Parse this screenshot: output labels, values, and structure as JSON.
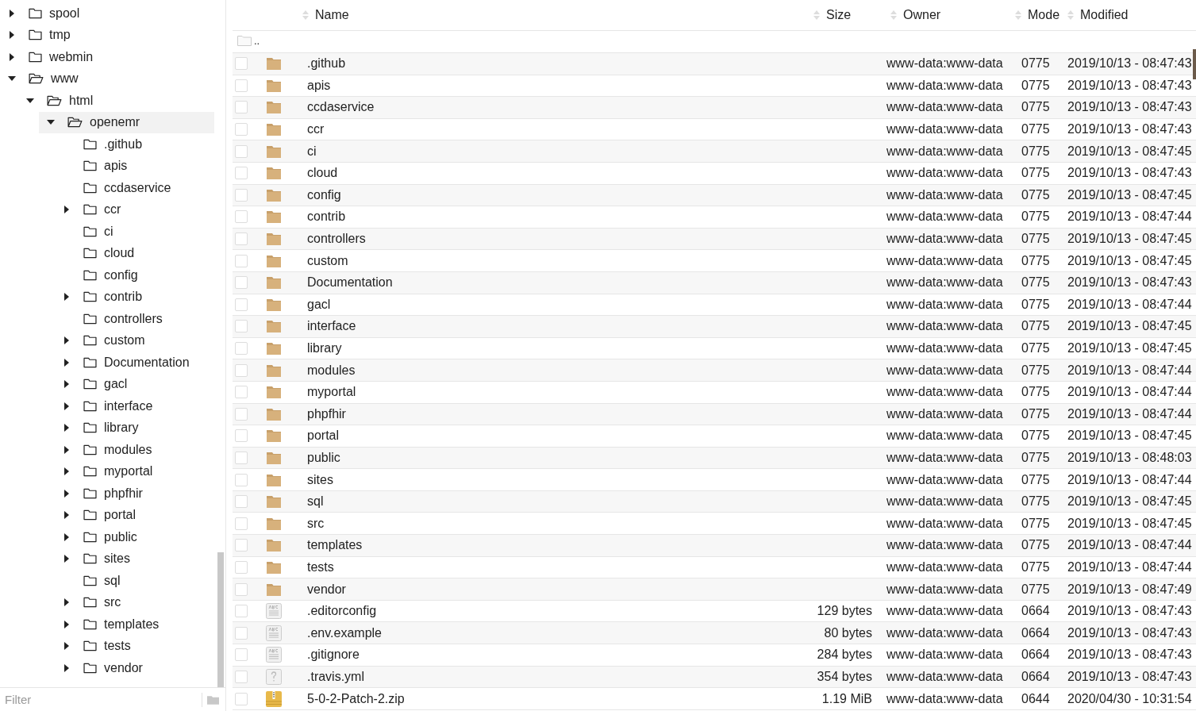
{
  "tree": [
    {
      "name": "spool",
      "expandable": true,
      "expanded": false,
      "selected": false
    },
    {
      "name": "tmp",
      "expandable": true,
      "expanded": false,
      "selected": false
    },
    {
      "name": "webmin",
      "expandable": true,
      "expanded": false,
      "selected": false
    },
    {
      "name": "www",
      "expandable": true,
      "expanded": true,
      "selected": false,
      "children": [
        {
          "name": "html",
          "expandable": true,
          "expanded": true,
          "selected": false,
          "children": [
            {
              "name": "openemr",
              "expandable": true,
              "expanded": true,
              "selected": true,
              "children": [
                {
                  "name": ".github",
                  "expandable": false,
                  "expanded": false,
                  "selected": false
                },
                {
                  "name": "apis",
                  "expandable": false,
                  "expanded": false,
                  "selected": false
                },
                {
                  "name": "ccdaservice",
                  "expandable": false,
                  "expanded": false,
                  "selected": false
                },
                {
                  "name": "ccr",
                  "expandable": true,
                  "expanded": false,
                  "selected": false
                },
                {
                  "name": "ci",
                  "expandable": false,
                  "expanded": false,
                  "selected": false
                },
                {
                  "name": "cloud",
                  "expandable": false,
                  "expanded": false,
                  "selected": false
                },
                {
                  "name": "config",
                  "expandable": false,
                  "expanded": false,
                  "selected": false
                },
                {
                  "name": "contrib",
                  "expandable": true,
                  "expanded": false,
                  "selected": false
                },
                {
                  "name": "controllers",
                  "expandable": false,
                  "expanded": false,
                  "selected": false
                },
                {
                  "name": "custom",
                  "expandable": true,
                  "expanded": false,
                  "selected": false
                },
                {
                  "name": "Documentation",
                  "expandable": true,
                  "expanded": false,
                  "selected": false
                },
                {
                  "name": "gacl",
                  "expandable": true,
                  "expanded": false,
                  "selected": false
                },
                {
                  "name": "interface",
                  "expandable": true,
                  "expanded": false,
                  "selected": false
                },
                {
                  "name": "library",
                  "expandable": true,
                  "expanded": false,
                  "selected": false
                },
                {
                  "name": "modules",
                  "expandable": true,
                  "expanded": false,
                  "selected": false
                },
                {
                  "name": "myportal",
                  "expandable": true,
                  "expanded": false,
                  "selected": false
                },
                {
                  "name": "phpfhir",
                  "expandable": true,
                  "expanded": false,
                  "selected": false
                },
                {
                  "name": "portal",
                  "expandable": true,
                  "expanded": false,
                  "selected": false
                },
                {
                  "name": "public",
                  "expandable": true,
                  "expanded": false,
                  "selected": false
                },
                {
                  "name": "sites",
                  "expandable": true,
                  "expanded": false,
                  "selected": false
                },
                {
                  "name": "sql",
                  "expandable": false,
                  "expanded": false,
                  "selected": false
                },
                {
                  "name": "src",
                  "expandable": true,
                  "expanded": false,
                  "selected": false
                },
                {
                  "name": "templates",
                  "expandable": true,
                  "expanded": false,
                  "selected": false
                },
                {
                  "name": "tests",
                  "expandable": true,
                  "expanded": false,
                  "selected": false
                },
                {
                  "name": "vendor",
                  "expandable": true,
                  "expanded": false,
                  "selected": false
                }
              ]
            }
          ]
        }
      ]
    }
  ],
  "filter": {
    "placeholder": "Filter"
  },
  "table": {
    "columns": [
      "Name",
      "Size",
      "Owner",
      "Mode",
      "Modified"
    ],
    "parent_row": {
      "name": ".."
    },
    "rows": [
      {
        "kind": "folder",
        "name": ".github",
        "owner": "www-data:www-data",
        "mode": "0775",
        "modified": "2019/10/13 - 08:47:43",
        "checked": false
      },
      {
        "kind": "folder",
        "name": "apis",
        "owner": "www-data:www-data",
        "mode": "0775",
        "modified": "2019/10/13 - 08:47:43",
        "checked": false
      },
      {
        "kind": "folder",
        "name": "ccdaservice",
        "owner": "www-data:www-data",
        "mode": "0775",
        "modified": "2019/10/13 - 08:47:43",
        "checked": false
      },
      {
        "kind": "folder",
        "name": "ccr",
        "owner": "www-data:www-data",
        "mode": "0775",
        "modified": "2019/10/13 - 08:47:43",
        "checked": false
      },
      {
        "kind": "folder",
        "name": "ci",
        "owner": "www-data:www-data",
        "mode": "0775",
        "modified": "2019/10/13 - 08:47:45",
        "checked": false
      },
      {
        "kind": "folder",
        "name": "cloud",
        "owner": "www-data:www-data",
        "mode": "0775",
        "modified": "2019/10/13 - 08:47:43",
        "checked": false
      },
      {
        "kind": "folder",
        "name": "config",
        "owner": "www-data:www-data",
        "mode": "0775",
        "modified": "2019/10/13 - 08:47:45",
        "checked": false
      },
      {
        "kind": "folder",
        "name": "contrib",
        "owner": "www-data:www-data",
        "mode": "0775",
        "modified": "2019/10/13 - 08:47:44",
        "checked": false
      },
      {
        "kind": "folder",
        "name": "controllers",
        "owner": "www-data:www-data",
        "mode": "0775",
        "modified": "2019/10/13 - 08:47:45",
        "checked": false
      },
      {
        "kind": "folder",
        "name": "custom",
        "owner": "www-data:www-data",
        "mode": "0775",
        "modified": "2019/10/13 - 08:47:45",
        "checked": false
      },
      {
        "kind": "folder",
        "name": "Documentation",
        "owner": "www-data:www-data",
        "mode": "0775",
        "modified": "2019/10/13 - 08:47:43",
        "checked": false
      },
      {
        "kind": "folder",
        "name": "gacl",
        "owner": "www-data:www-data",
        "mode": "0775",
        "modified": "2019/10/13 - 08:47:44",
        "checked": false
      },
      {
        "kind": "folder",
        "name": "interface",
        "owner": "www-data:www-data",
        "mode": "0775",
        "modified": "2019/10/13 - 08:47:45",
        "checked": false
      },
      {
        "kind": "folder",
        "name": "library",
        "owner": "www-data:www-data",
        "mode": "0775",
        "modified": "2019/10/13 - 08:47:45",
        "checked": false
      },
      {
        "kind": "folder",
        "name": "modules",
        "owner": "www-data:www-data",
        "mode": "0775",
        "modified": "2019/10/13 - 08:47:44",
        "checked": false
      },
      {
        "kind": "folder",
        "name": "myportal",
        "owner": "www-data:www-data",
        "mode": "0775",
        "modified": "2019/10/13 - 08:47:44",
        "checked": false
      },
      {
        "kind": "folder",
        "name": "phpfhir",
        "owner": "www-data:www-data",
        "mode": "0775",
        "modified": "2019/10/13 - 08:47:44",
        "checked": false
      },
      {
        "kind": "folder",
        "name": "portal",
        "owner": "www-data:www-data",
        "mode": "0775",
        "modified": "2019/10/13 - 08:47:45",
        "checked": false
      },
      {
        "kind": "folder",
        "name": "public",
        "owner": "www-data:www-data",
        "mode": "0775",
        "modified": "2019/10/13 - 08:48:03",
        "checked": false
      },
      {
        "kind": "folder",
        "name": "sites",
        "owner": "www-data:www-data",
        "mode": "0775",
        "modified": "2019/10/13 - 08:47:44",
        "checked": false
      },
      {
        "kind": "folder",
        "name": "sql",
        "owner": "www-data:www-data",
        "mode": "0775",
        "modified": "2019/10/13 - 08:47:45",
        "checked": false
      },
      {
        "kind": "folder",
        "name": "src",
        "owner": "www-data:www-data",
        "mode": "0775",
        "modified": "2019/10/13 - 08:47:45",
        "checked": false
      },
      {
        "kind": "folder",
        "name": "templates",
        "owner": "www-data:www-data",
        "mode": "0775",
        "modified": "2019/10/13 - 08:47:44",
        "checked": false
      },
      {
        "kind": "folder",
        "name": "tests",
        "owner": "www-data:www-data",
        "mode": "0775",
        "modified": "2019/10/13 - 08:47:44",
        "checked": false
      },
      {
        "kind": "folder",
        "name": "vendor",
        "owner": "www-data:www-data",
        "mode": "0775",
        "modified": "2019/10/13 - 08:47:49",
        "checked": false
      },
      {
        "kind": "text",
        "name": ".editorconfig",
        "size": "129 bytes",
        "owner": "www-data:www-data",
        "mode": "0664",
        "modified": "2019/10/13 - 08:47:43",
        "checked": false
      },
      {
        "kind": "text",
        "name": ".env.example",
        "size": "80 bytes",
        "owner": "www-data:www-data",
        "mode": "0664",
        "modified": "2019/10/13 - 08:47:43",
        "checked": false
      },
      {
        "kind": "text",
        "name": ".gitignore",
        "size": "284 bytes",
        "owner": "www-data:www-data",
        "mode": "0664",
        "modified": "2019/10/13 - 08:47:43",
        "checked": false
      },
      {
        "kind": "unknown",
        "name": ".travis.yml",
        "size": "354 bytes",
        "owner": "www-data:www-data",
        "mode": "0664",
        "modified": "2019/10/13 - 08:47:43",
        "checked": false
      },
      {
        "kind": "archive",
        "name": "5-0-2-Patch-2.zip",
        "size": "1.19 MiB",
        "owner": "www-data:www-data",
        "mode": "0644",
        "modified": "2020/04/30 - 10:31:54",
        "checked": false
      }
    ]
  }
}
